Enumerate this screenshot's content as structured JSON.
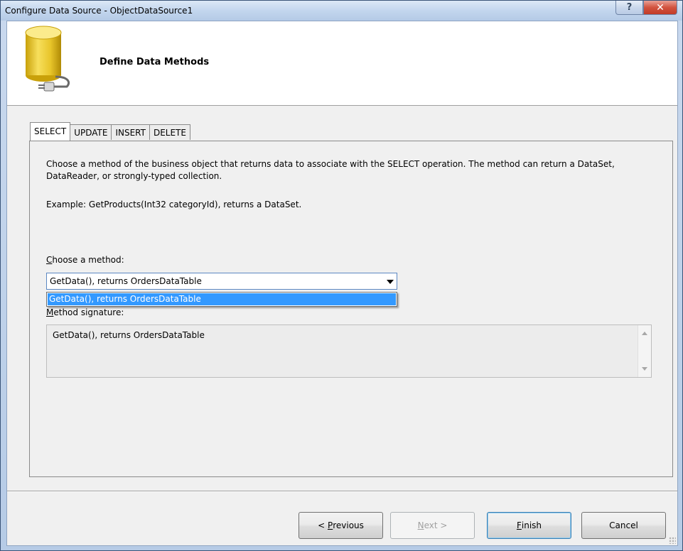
{
  "window": {
    "title": "Configure Data Source - ObjectDataSource1",
    "help_glyph": "?",
    "close_glyph": "✕"
  },
  "header": {
    "title": "Define Data Methods",
    "icon": "database-plug-icon"
  },
  "tabs": [
    {
      "label": "SELECT",
      "active": true
    },
    {
      "label": "UPDATE",
      "active": false
    },
    {
      "label": "INSERT",
      "active": false
    },
    {
      "label": "DELETE",
      "active": false
    }
  ],
  "panel": {
    "description": "Choose a method of the business object that returns data to associate with the SELECT operation. The method can return a DataSet, DataReader, or strongly-typed collection.",
    "example": "Example: GetProducts(Int32 categoryId), returns a DataSet.",
    "choose_label_first": "C",
    "choose_label_rest": "hoose a method:",
    "method_selected": "GetData(), returns OrdersDataTable",
    "dropdown_options": [
      "GetData(), returns OrdersDataTable"
    ],
    "signature_label_first": "M",
    "signature_label_rest": "ethod signature:",
    "signature_value": "GetData(), returns OrdersDataTable"
  },
  "buttons": {
    "previous_prefix": "< ",
    "previous_accel": "P",
    "previous_rest": "revious",
    "next_accel": "N",
    "next_rest": "ext >",
    "finish_accel": "F",
    "finish_rest": "inish",
    "cancel": "Cancel"
  },
  "colors": {
    "selection": "#3399ff",
    "title_bar": "#c3d6ee",
    "close_button": "#c13a26"
  }
}
